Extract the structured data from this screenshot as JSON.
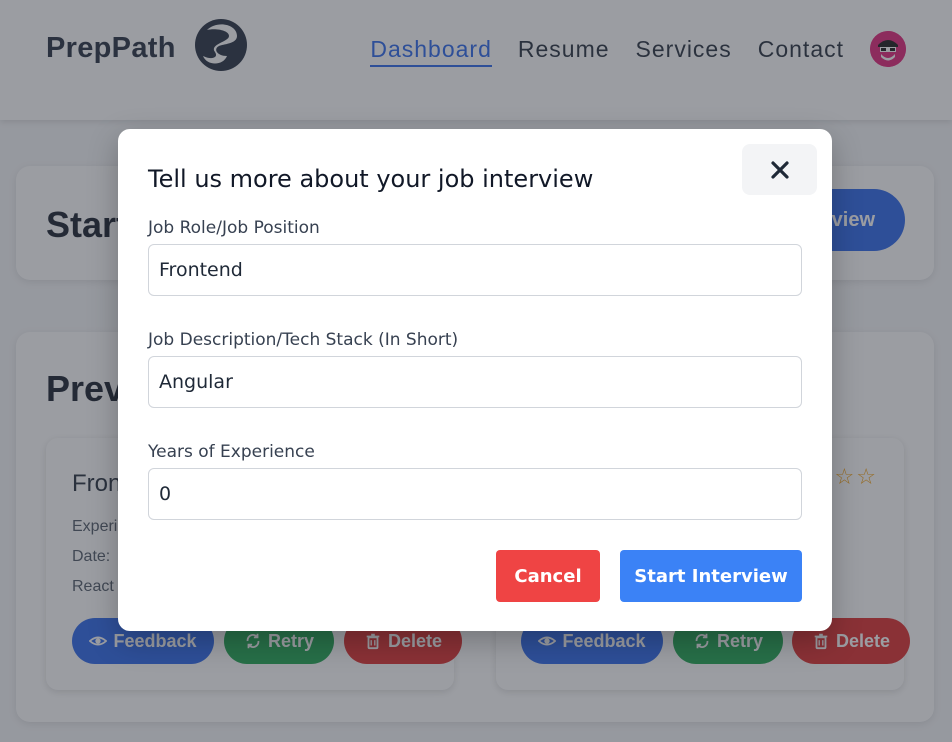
{
  "nav": {
    "brand": "PrepPath",
    "links": [
      {
        "label": "Dashboard",
        "active": true
      },
      {
        "label": "Resume"
      },
      {
        "label": "Services"
      },
      {
        "label": "Contact"
      }
    ]
  },
  "start_section": {
    "title": "Start a New Interview",
    "button_label": "Start Interview"
  },
  "previous_section": {
    "title": "Previous Interviews",
    "cards": [
      {
        "title": "Frontend",
        "experience": "Experience: 0",
        "date": "Date:",
        "stack": "React",
        "rating_stars": 5,
        "buttons": {
          "feedback": "Feedback",
          "retry": "Retry",
          "delete": "Delete"
        }
      },
      {
        "title": "",
        "rating_stars": 5,
        "buttons": {
          "feedback": "Feedback",
          "retry": "Retry",
          "delete": "Delete"
        }
      }
    ]
  },
  "modal": {
    "title": "Tell us more about your job interview",
    "fields": {
      "role": {
        "label": "Job Role/Job Position",
        "value": "Frontend"
      },
      "description": {
        "label": "Job Description/Tech Stack (In Short)",
        "value": "Angular"
      },
      "experience": {
        "label": "Years of Experience",
        "value": "0"
      }
    },
    "cancel_label": "Cancel",
    "start_label": "Start Interview"
  },
  "colors": {
    "primary": "#3b82f6",
    "danger": "#ef4444",
    "success": "#16a34a",
    "brand_dark": "#1e293b"
  }
}
